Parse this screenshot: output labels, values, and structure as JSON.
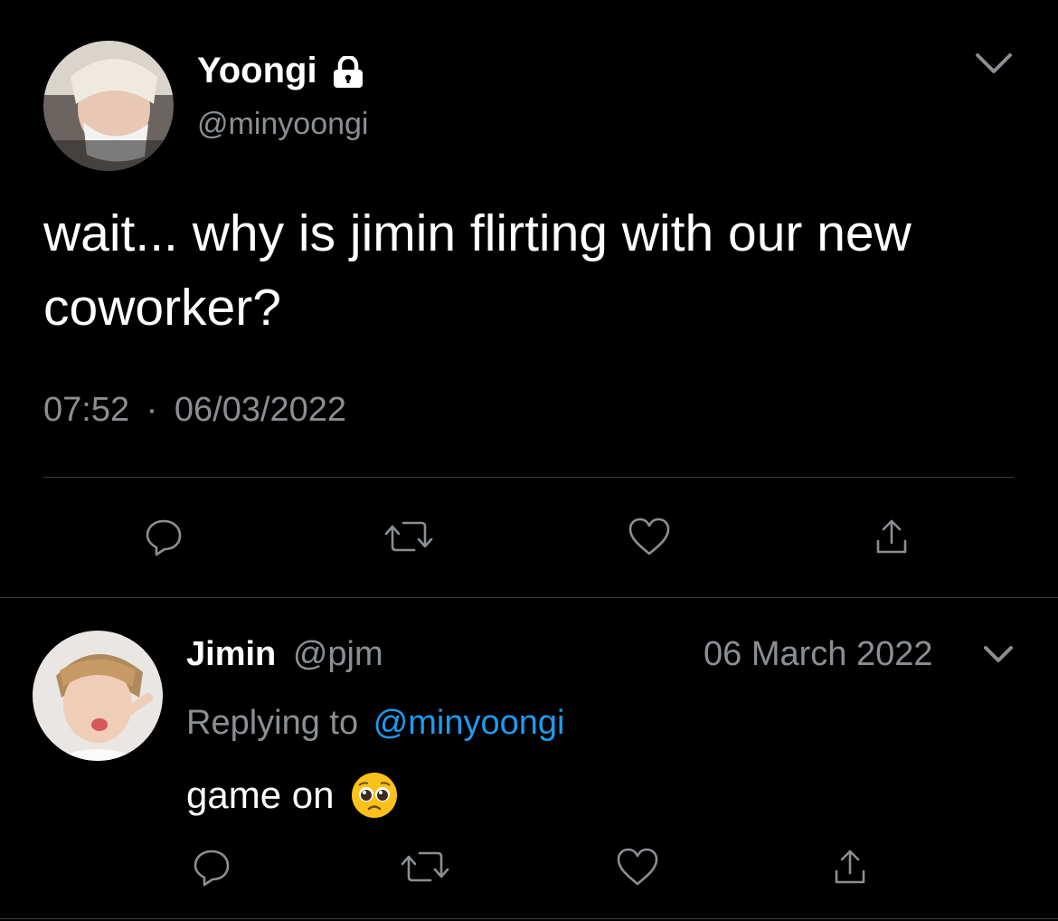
{
  "main_tweet": {
    "author_name": "Yoongi",
    "author_handle": "@minyoongi",
    "protected_icon": "lock-icon",
    "menu_icon": "chevron-down-icon",
    "text_line1": "wait... why is jimin flirting with our new",
    "text_line2": "coworker?",
    "time": "07:52",
    "separator": "·",
    "date": "06/03/2022",
    "actions": [
      "reply-icon",
      "retweet-icon",
      "like-icon",
      "share-icon"
    ]
  },
  "reply_tweet": {
    "author_name": "Jimin",
    "author_handle": "@pjm",
    "date": "06 March 2022",
    "menu_icon": "chevron-down-icon",
    "replying_prefix": "Replying to",
    "replying_handle": "@minyoongi",
    "text": "game on",
    "emoji": "pleading-face-emoji",
    "actions": [
      "reply-icon",
      "retweet-icon",
      "like-icon",
      "share-icon"
    ]
  },
  "colors": {
    "background": "#000000",
    "text": "#ffffff",
    "muted": "#8b8f93",
    "link": "#1d9bf0",
    "divider": "#3a3d41"
  }
}
